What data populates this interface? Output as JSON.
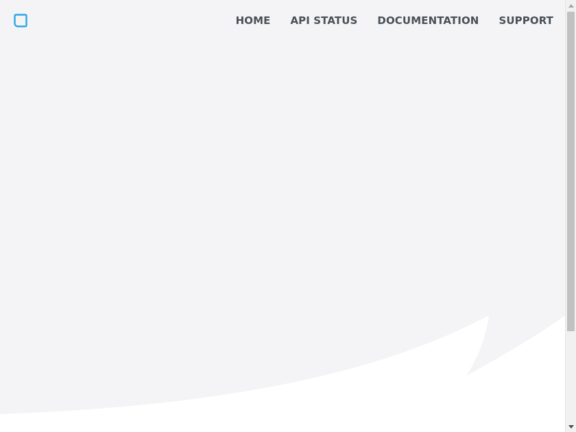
{
  "nav": {
    "logo_icon": "rounded-square-logo-icon",
    "links": [
      {
        "label": "HOME"
      },
      {
        "label": "API STATUS"
      },
      {
        "label": "DOCUMENTATION"
      },
      {
        "label": "SUPPORT"
      }
    ]
  },
  "colors": {
    "hero_background": "#f4f4f6",
    "page_background": "#ffffff",
    "nav_text": "#495057",
    "logo_accent": "#29a8e0"
  }
}
